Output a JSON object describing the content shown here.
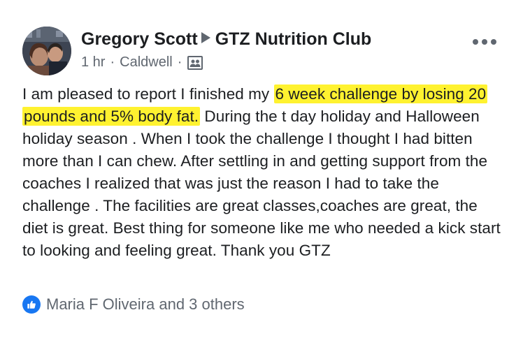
{
  "post": {
    "author": "Gregory Scott",
    "group": "GTZ Nutrition Club",
    "time": "1 hr",
    "location": "Caldwell",
    "separator": "·",
    "audience_icon": "group-audience-icon",
    "text_highlighted": "6 week challenge by losing 20 pounds and 5% body fat.",
    "text_before": "I am pleased to report I finished my ",
    "text_after": " During the t day holiday and Halloween holiday season . When I took the challenge I thought I had bitten more than I can chew. After settling in and getting support from the coaches I realized that was just the reason I had to take the challenge . The facilities are great classes,coaches are great, the diet is great. Best thing for someone like me who needed a kick start to looking and feeling great. Thank you GTZ",
    "highlight_color": "#fff230"
  },
  "reactions": {
    "icon": "like-icon",
    "text": "Maria F Oliveira and 3 others",
    "color": "#1877f2"
  }
}
